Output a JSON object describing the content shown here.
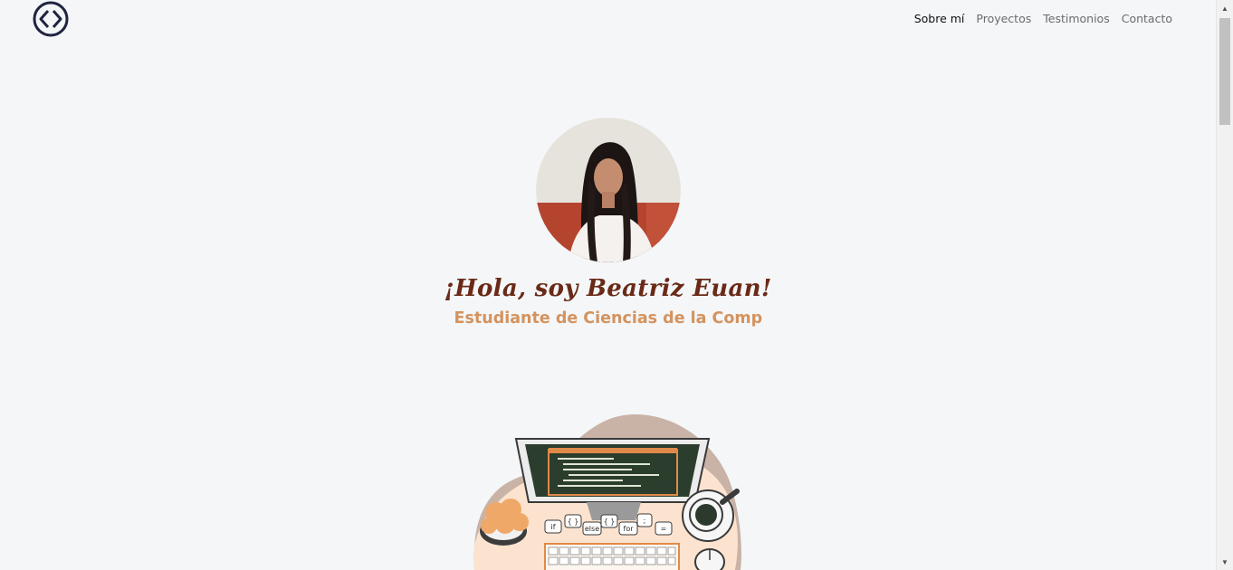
{
  "nav": {
    "logo_icon": "code-brackets-icon",
    "links": [
      {
        "label": "Sobre mí",
        "active": true
      },
      {
        "label": "Proyectos",
        "active": false
      },
      {
        "label": "Testimonios",
        "active": false
      },
      {
        "label": "Contacto",
        "active": false
      }
    ]
  },
  "hero": {
    "greeting": "¡Hola, soy Beatriz Euan!",
    "subtitle": "Estudiante de Ciencias de la Computac"
  },
  "illustration": {
    "keyboard_keys": [
      "if",
      "{ }",
      "else",
      "{ }",
      "for",
      ";",
      "="
    ]
  },
  "colors": {
    "background": "#f4f6f8",
    "greeting": "#6a2a17",
    "subtitle": "#d4935e",
    "logo": "#1f2440"
  }
}
